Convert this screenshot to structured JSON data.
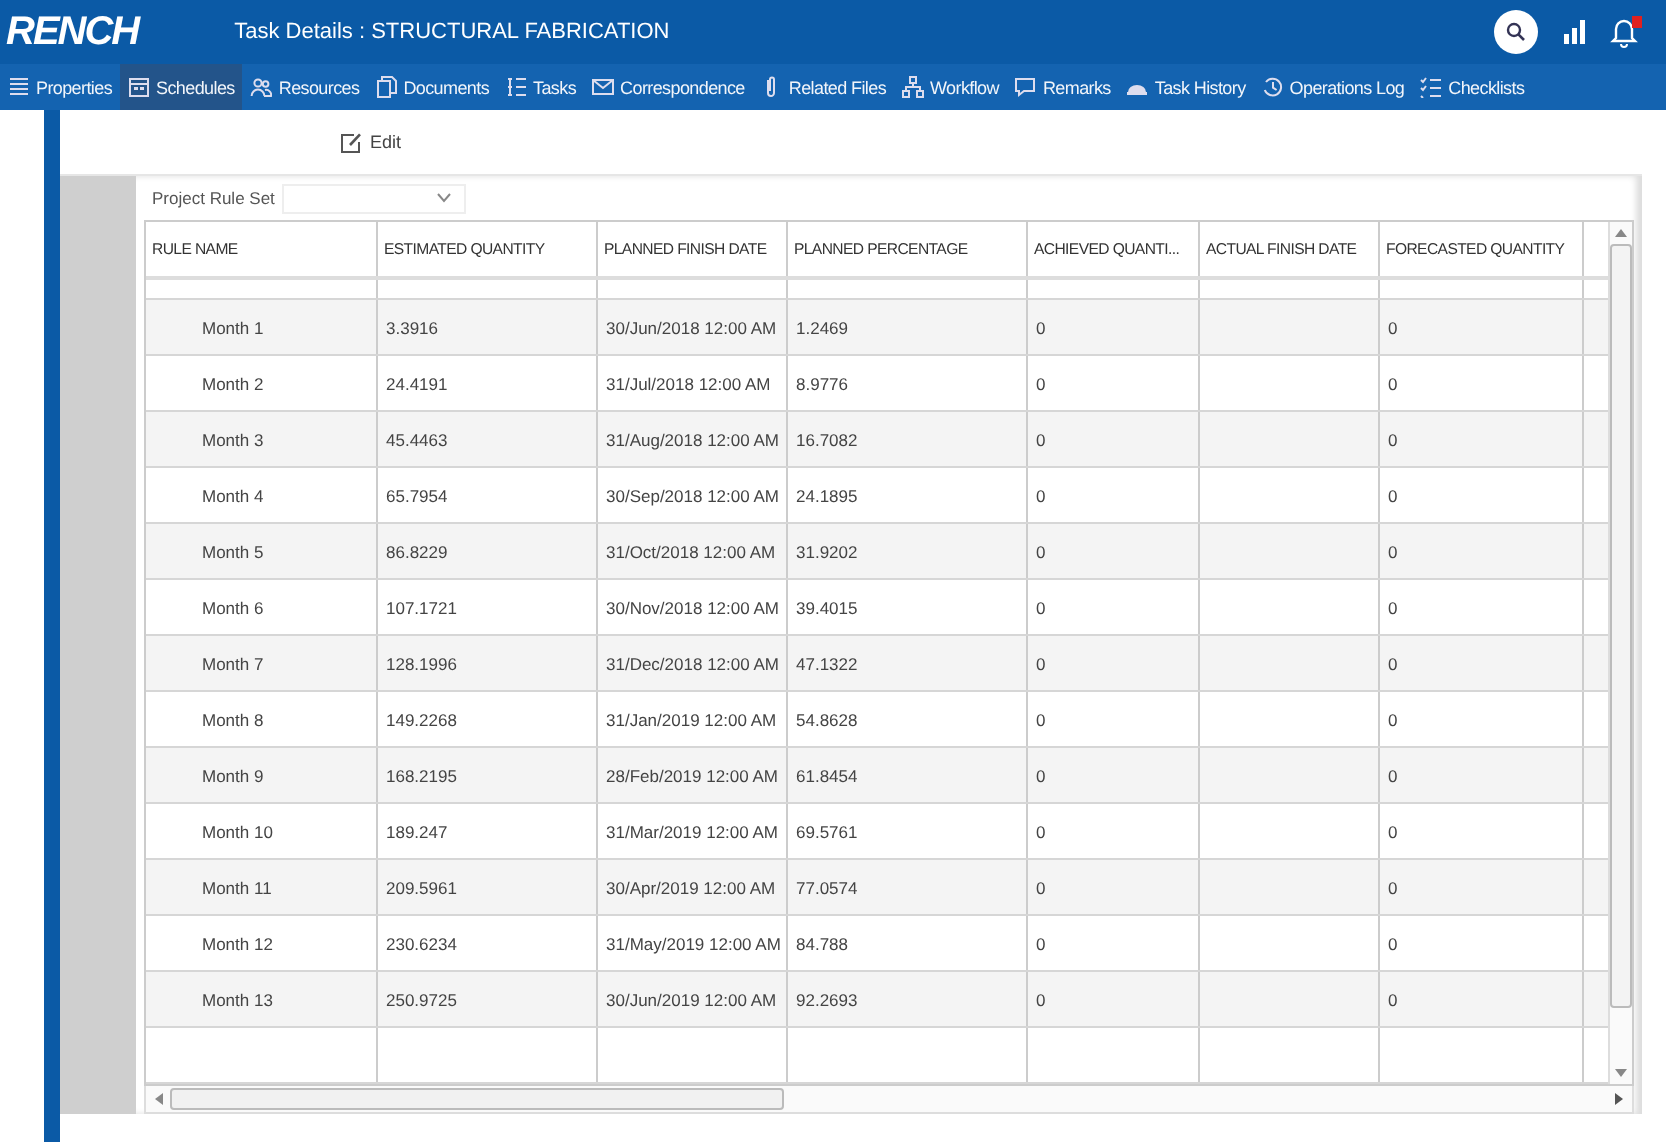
{
  "header": {
    "logo": "RENCH",
    "title": "Task Details : STRUCTURAL FABRICATION",
    "notification_badge": true
  },
  "tabs": [
    {
      "label": "Properties",
      "selected": false
    },
    {
      "label": "Schedules",
      "selected": true
    },
    {
      "label": "Resources",
      "selected": false
    },
    {
      "label": "Documents",
      "selected": false
    },
    {
      "label": "Tasks",
      "selected": false
    },
    {
      "label": "Correspondence",
      "selected": false
    },
    {
      "label": "Related Files",
      "selected": false
    },
    {
      "label": "Workflow",
      "selected": false
    },
    {
      "label": "Remarks",
      "selected": false
    },
    {
      "label": "Task History",
      "selected": false
    },
    {
      "label": "Operations Log",
      "selected": false
    },
    {
      "label": "Checklists",
      "selected": false
    }
  ],
  "toolbar": {
    "edit_button": "Edit"
  },
  "project_rule_set": {
    "label": "Project Rule Set"
  },
  "table": {
    "columns": [
      "RULE NAME",
      "ESTIMATED QUANTITY",
      "PLANNED FINISH DATE",
      "PLANNED PERCENTAGE",
      "ACHIEVED QUANTI...",
      "ACTUAL FINISH DATE",
      "FORECASTED QUANTITY"
    ],
    "rows": [
      {
        "rule_name": "Month 1",
        "estimated_quantity": "3.3916",
        "planned_finish_date": "30/Jun/2018 12:00 AM",
        "planned_percentage": "1.2469",
        "achieved_quantity": "0",
        "forecasted_quantity": "0"
      },
      {
        "rule_name": "Month 2",
        "estimated_quantity": "24.4191",
        "planned_finish_date": "31/Jul/2018 12:00 AM",
        "planned_percentage": "8.9776",
        "achieved_quantity": "0",
        "forecasted_quantity": "0"
      },
      {
        "rule_name": "Month 3",
        "estimated_quantity": "45.4463",
        "planned_finish_date": "31/Aug/2018 12:00 AM",
        "planned_percentage": "16.7082",
        "achieved_quantity": "0",
        "forecasted_quantity": "0"
      },
      {
        "rule_name": "Month 4",
        "estimated_quantity": "65.7954",
        "planned_finish_date": "30/Sep/2018 12:00 AM",
        "planned_percentage": "24.1895",
        "achieved_quantity": "0",
        "forecasted_quantity": "0"
      },
      {
        "rule_name": "Month 5",
        "estimated_quantity": "86.8229",
        "planned_finish_date": "31/Oct/2018 12:00 AM",
        "planned_percentage": "31.9202",
        "achieved_quantity": "0",
        "forecasted_quantity": "0"
      },
      {
        "rule_name": "Month 6",
        "estimated_quantity": "107.1721",
        "planned_finish_date": "30/Nov/2018 12:00 AM",
        "planned_percentage": "39.4015",
        "achieved_quantity": "0",
        "forecasted_quantity": "0"
      },
      {
        "rule_name": "Month 7",
        "estimated_quantity": "128.1996",
        "planned_finish_date": "31/Dec/2018 12:00 AM",
        "planned_percentage": "47.1322",
        "achieved_quantity": "0",
        "forecasted_quantity": "0"
      },
      {
        "rule_name": "Month 8",
        "estimated_quantity": "149.2268",
        "planned_finish_date": "31/Jan/2019 12:00 AM",
        "planned_percentage": "54.8628",
        "achieved_quantity": "0",
        "forecasted_quantity": "0"
      },
      {
        "rule_name": "Month 9",
        "estimated_quantity": "168.2195",
        "planned_finish_date": "28/Feb/2019 12:00 AM",
        "planned_percentage": "61.8454",
        "achieved_quantity": "0",
        "forecasted_quantity": "0"
      },
      {
        "rule_name": "Month 10",
        "estimated_quantity": "189.247",
        "planned_finish_date": "31/Mar/2019 12:00 AM",
        "planned_percentage": "69.5761",
        "achieved_quantity": "0",
        "forecasted_quantity": "0"
      },
      {
        "rule_name": "Month 11",
        "estimated_quantity": "209.5961",
        "planned_finish_date": "30/Apr/2019 12:00 AM",
        "planned_percentage": "77.0574",
        "achieved_quantity": "0",
        "forecasted_quantity": "0"
      },
      {
        "rule_name": "Month 12",
        "estimated_quantity": "230.6234",
        "planned_finish_date": "31/May/2019 12:00 AM",
        "planned_percentage": "84.788",
        "achieved_quantity": "0",
        "forecasted_quantity": "0"
      },
      {
        "rule_name": "Month 13",
        "estimated_quantity": "250.9725",
        "planned_finish_date": "30/Jun/2019 12:00 AM",
        "planned_percentage": "92.2693",
        "achieved_quantity": "0",
        "forecasted_quantity": "0"
      }
    ]
  }
}
